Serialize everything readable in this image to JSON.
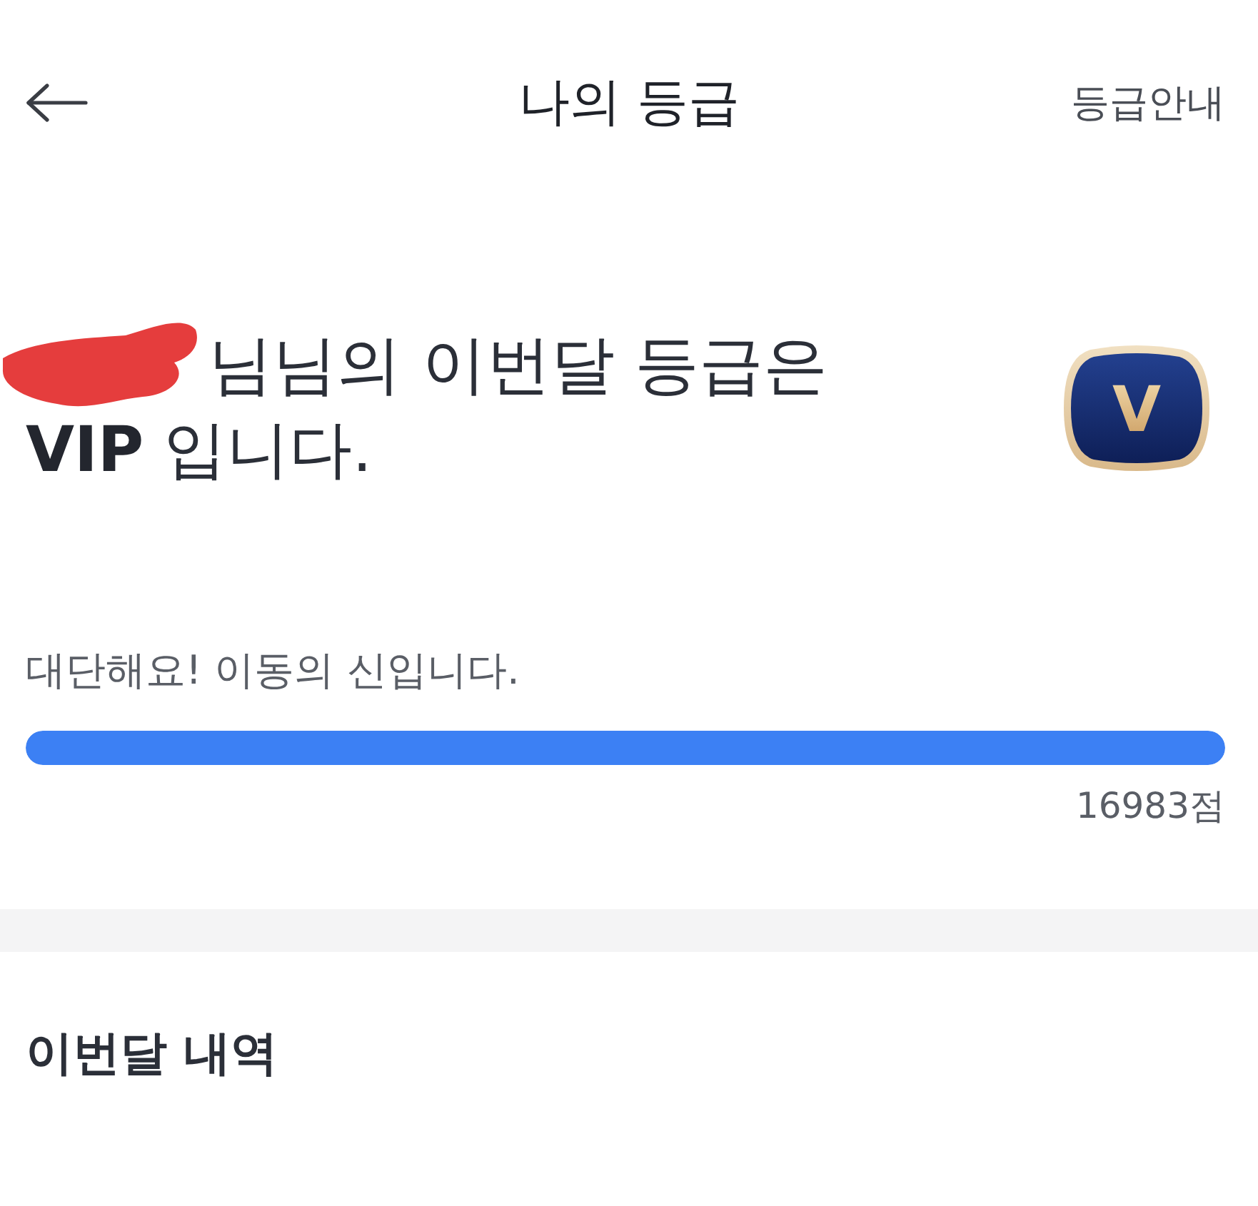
{
  "header": {
    "title": "나의 등급",
    "guide_link": "등급안내"
  },
  "summary": {
    "greeting": "님님의 이번달 등급은",
    "grade_line": "**VIP** 입니다.",
    "badge_letter": "V"
  },
  "progress": {
    "message": "대단해요! 이동의 신입니다.",
    "level": 1,
    "points": "16983점"
  },
  "history": {
    "title": "이번달 내역"
  }
}
